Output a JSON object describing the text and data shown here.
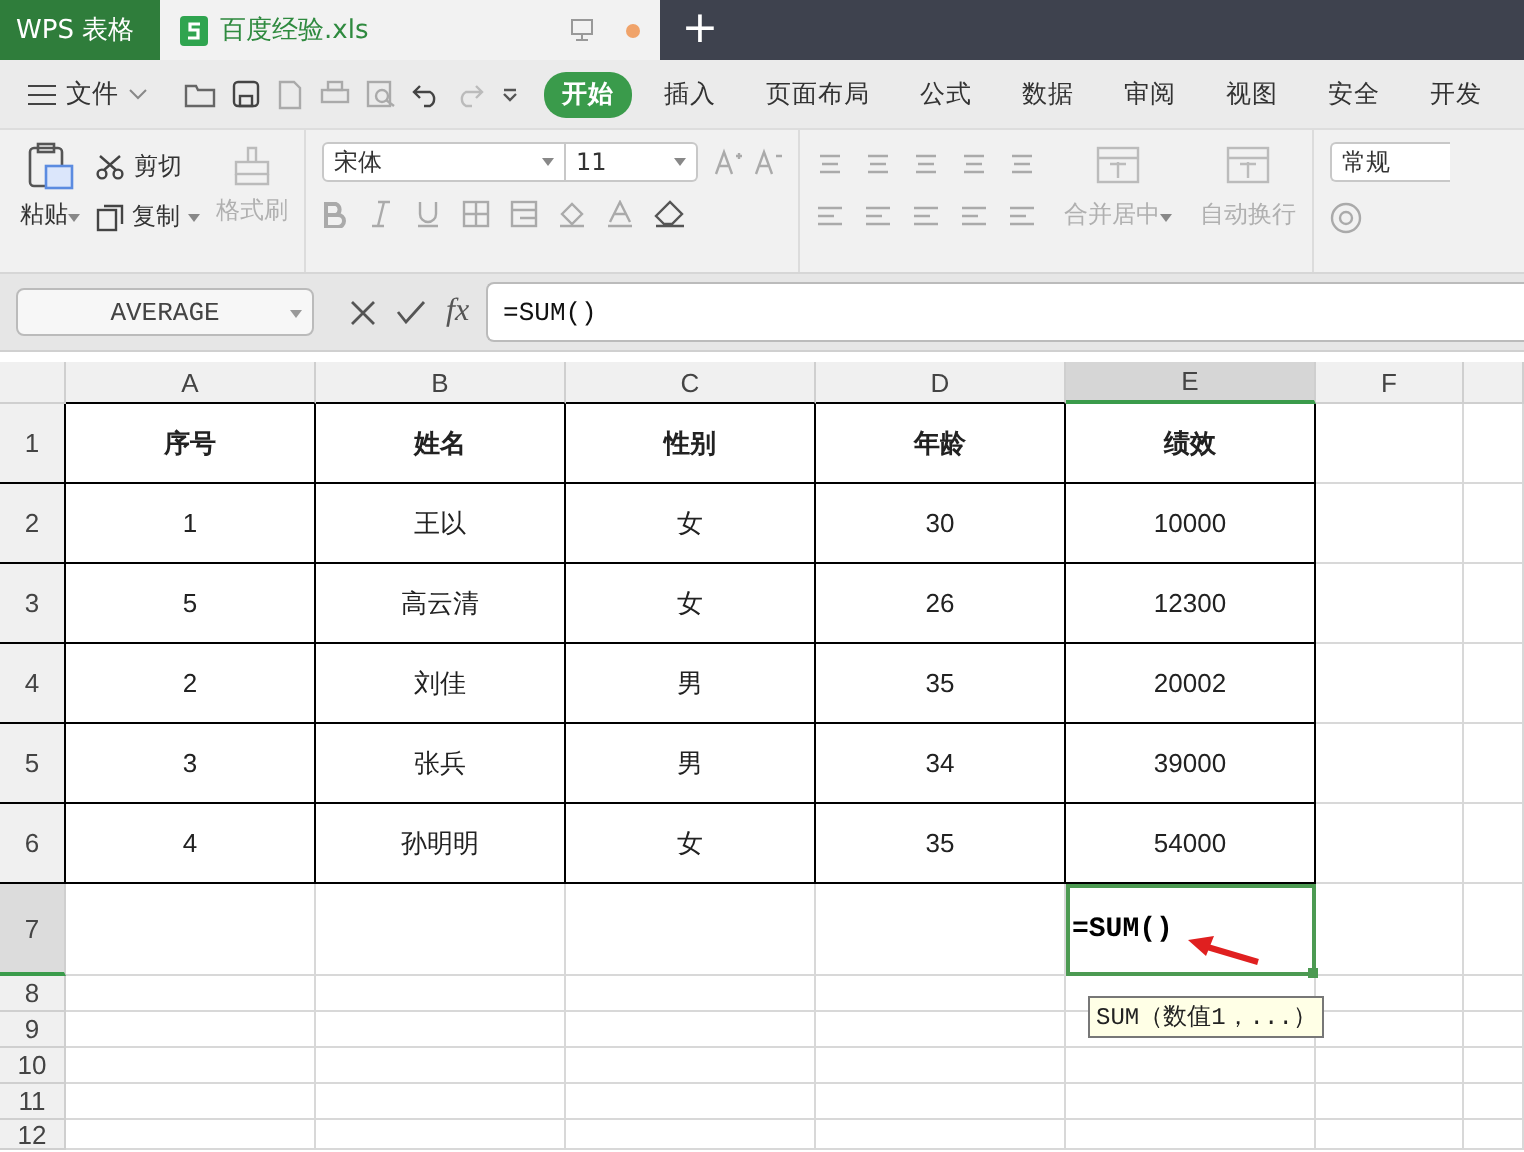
{
  "title_bar": {
    "app_tab": "WPS 表格",
    "file_tab": "百度经验.xls",
    "new_tab": "+"
  },
  "menu_bar": {
    "file_menu": "文件",
    "tabs": [
      {
        "label": "开始",
        "selected": true
      },
      {
        "label": "插入",
        "selected": false
      },
      {
        "label": "页面布局",
        "selected": false
      },
      {
        "label": "公式",
        "selected": false
      },
      {
        "label": "数据",
        "selected": false
      },
      {
        "label": "审阅",
        "selected": false
      },
      {
        "label": "视图",
        "selected": false
      },
      {
        "label": "安全",
        "selected": false
      },
      {
        "label": "开发",
        "selected": false
      }
    ]
  },
  "ribbon": {
    "paste": {
      "label": "粘贴",
      "disabled": false
    },
    "clipboard": [
      {
        "label": "剪切",
        "disabled": false
      },
      {
        "label": "复制",
        "disabled": false
      }
    ],
    "format_painter": {
      "label": "格式刷",
      "disabled": true
    },
    "font_name": "宋体",
    "font_size": "11",
    "alignment_buttons": [
      {
        "label": "合并居中",
        "disabled": true
      },
      {
        "label": "自动换行",
        "disabled": true
      }
    ],
    "number_format": "常规"
  },
  "formula_bar": {
    "name_box": "AVERAGE",
    "fx": "fx",
    "formula": "=SUM()"
  },
  "sheet": {
    "columns": [
      {
        "label": "A",
        "selected": false
      },
      {
        "label": "B",
        "selected": false
      },
      {
        "label": "C",
        "selected": false
      },
      {
        "label": "D",
        "selected": false
      },
      {
        "label": "E",
        "selected": true
      },
      {
        "label": "F",
        "selected": false
      }
    ],
    "rows": [
      {
        "label": "1",
        "selected": false,
        "kind": "header",
        "cells": [
          "序号",
          "姓名",
          "性别",
          "年龄",
          "绩效"
        ]
      },
      {
        "label": "2",
        "selected": false,
        "kind": "data",
        "cells": [
          "1",
          "王以",
          "女",
          "30",
          "10000"
        ]
      },
      {
        "label": "3",
        "selected": false,
        "kind": "data",
        "cells": [
          "5",
          "高云清",
          "女",
          "26",
          "12300"
        ]
      },
      {
        "label": "4",
        "selected": false,
        "kind": "data",
        "cells": [
          "2",
          "刘佳",
          "男",
          "35",
          "20002"
        ]
      },
      {
        "label": "5",
        "selected": false,
        "kind": "data",
        "cells": [
          "3",
          "张兵",
          "男",
          "34",
          "39000"
        ]
      },
      {
        "label": "6",
        "selected": false,
        "kind": "data",
        "cells": [
          "4",
          "孙明明",
          "女",
          "35",
          "54000"
        ]
      },
      {
        "label": "7",
        "selected": true,
        "kind": "input",
        "input": "=SUM()"
      },
      {
        "label": "8",
        "selected": false,
        "kind": "empty"
      },
      {
        "label": "9",
        "selected": false,
        "kind": "empty"
      },
      {
        "label": "10",
        "selected": false,
        "kind": "empty"
      },
      {
        "label": "11",
        "selected": false,
        "kind": "empty"
      },
      {
        "label": "12",
        "selected": false,
        "kind": "empty"
      }
    ],
    "tooltip": "SUM（数值1，...）"
  }
}
